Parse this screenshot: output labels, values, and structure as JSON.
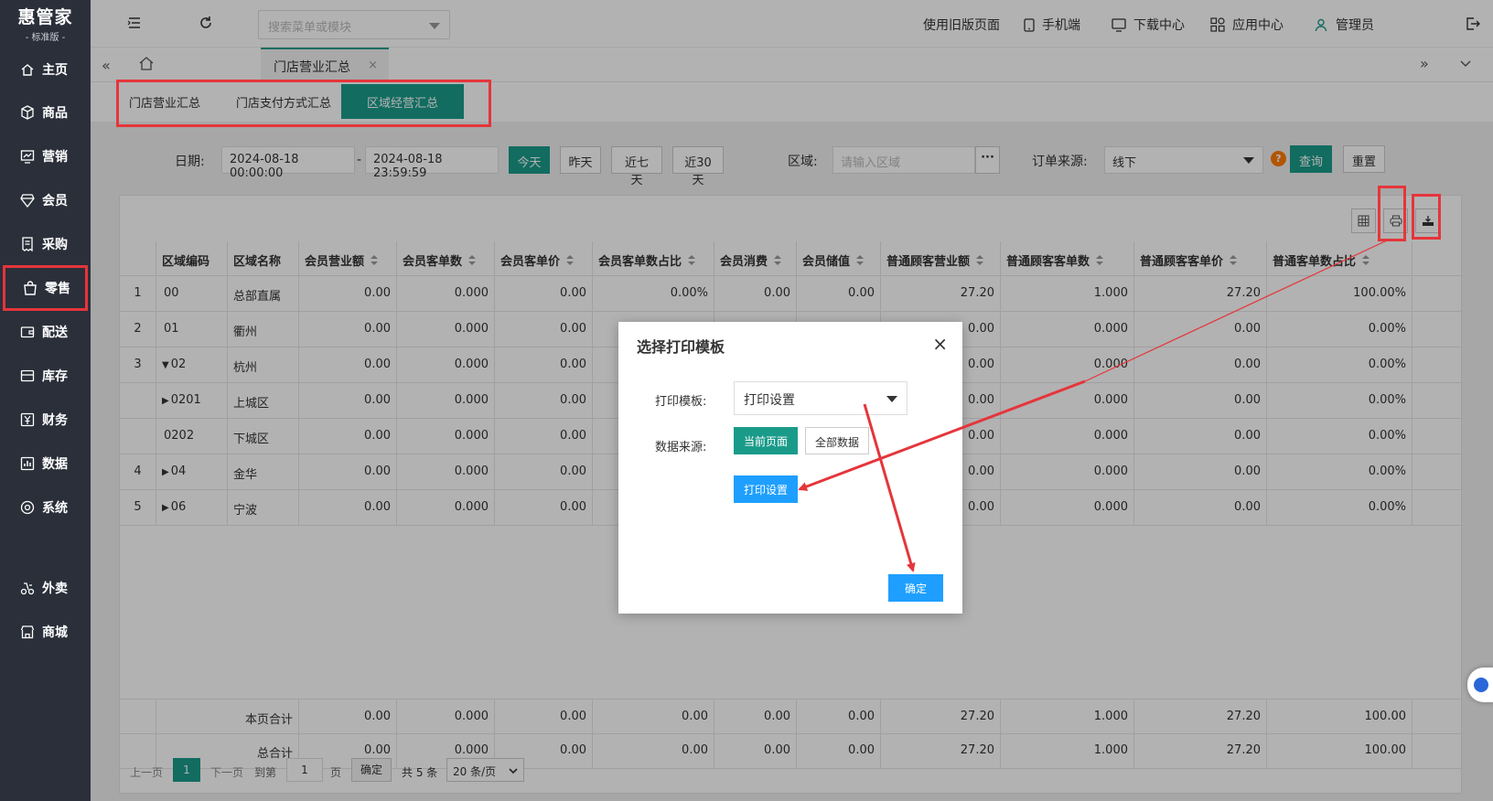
{
  "sidebar": {
    "logo_title": "惠管家",
    "logo_subtitle": "- 标准版 -",
    "items": [
      {
        "label": "主页",
        "icon": "home-icon"
      },
      {
        "label": "商品",
        "icon": "box-icon"
      },
      {
        "label": "营销",
        "icon": "chart-board-icon"
      },
      {
        "label": "会员",
        "icon": "diamond-icon"
      },
      {
        "label": "采购",
        "icon": "receipt-icon"
      },
      {
        "label": "零售",
        "icon": "bag-icon"
      },
      {
        "label": "配送",
        "icon": "wallet-icon"
      },
      {
        "label": "库存",
        "icon": "stack-icon"
      },
      {
        "label": "财务",
        "icon": "yen-icon"
      },
      {
        "label": "数据",
        "icon": "bar-chart-icon"
      },
      {
        "label": "系统",
        "icon": "settings-icon"
      },
      {
        "label": "外卖",
        "icon": "takeout-icon"
      },
      {
        "label": "商城",
        "icon": "shop-icon"
      }
    ]
  },
  "header": {
    "search_placeholder": "搜索菜单或模块",
    "old_page": "使用旧版页面",
    "mobile": "手机端",
    "download": "下载中心",
    "apps": "应用中心",
    "user": "管理员"
  },
  "tabs": {
    "active": "门店营业汇总"
  },
  "subtabs": [
    "门店营业汇总",
    "门店支付方式汇总",
    "区域经营汇总"
  ],
  "filter": {
    "date_label": "日期:",
    "date_start": "2024-08-18 00:00:00",
    "date_sep": "-",
    "date_end": "2024-08-18 23:59:59",
    "today": "今天",
    "yesterday": "昨天",
    "last7": "近七天",
    "last30": "近30天",
    "region_label": "区域:",
    "region_placeholder": "请输入区域",
    "region_more": "···",
    "source_label": "订单来源:",
    "source_value": "线下",
    "help": "?",
    "query": "查询",
    "reset": "重置"
  },
  "table": {
    "columns": [
      "区域编码",
      "区域名称",
      "会员营业额",
      "会员客单数",
      "会员客单价",
      "会员客单数占比",
      "会员消费",
      "会员储值",
      "普通顾客营业额",
      "普通顾客客单数",
      "普通顾客客单价",
      "普通客单数占比"
    ],
    "rows": [
      {
        "idx": "1",
        "code": "00",
        "expand": "",
        "name": "总部直属",
        "v": [
          "0.00",
          "0.000",
          "0.00",
          "0.00%",
          "0.00",
          "0.00",
          "27.20",
          "1.000",
          "27.20",
          "100.00%"
        ]
      },
      {
        "idx": "2",
        "code": "01",
        "expand": "",
        "name": "衢州",
        "v": [
          "0.00",
          "0.000",
          "0.00",
          "",
          "",
          "",
          "0.00",
          "0.000",
          "0.00",
          "0.00%"
        ]
      },
      {
        "idx": "3",
        "code": "02",
        "expand": "▼",
        "name": "杭州",
        "v": [
          "0.00",
          "0.000",
          "0.00",
          "",
          "",
          "",
          "0.00",
          "0.000",
          "0.00",
          "0.00%"
        ]
      },
      {
        "idx": "",
        "code": "0201",
        "expand": "▶",
        "name": "上城区",
        "v": [
          "0.00",
          "0.000",
          "0.00",
          "",
          "",
          "",
          "0.00",
          "0.000",
          "0.00",
          "0.00%"
        ]
      },
      {
        "idx": "",
        "code": "0202",
        "expand": "",
        "name": "下城区",
        "v": [
          "0.00",
          "0.000",
          "0.00",
          "",
          "",
          "",
          "0.00",
          "0.000",
          "0.00",
          "0.00%"
        ]
      },
      {
        "idx": "4",
        "code": "04",
        "expand": "▶",
        "name": "金华",
        "v": [
          "0.00",
          "0.000",
          "0.00",
          "",
          "",
          "",
          "0.00",
          "0.000",
          "0.00",
          "0.00%"
        ]
      },
      {
        "idx": "5",
        "code": "06",
        "expand": "▶",
        "name": "宁波",
        "v": [
          "0.00",
          "0.000",
          "0.00",
          "",
          "",
          "",
          "0.00",
          "0.000",
          "0.00",
          "0.00%"
        ]
      }
    ],
    "totals": [
      {
        "label": "本页合计",
        "v": [
          "0.00",
          "0.000",
          "0.00",
          "0.00",
          "0.00",
          "0.00",
          "27.20",
          "1.000",
          "27.20",
          "100.00"
        ]
      },
      {
        "label": "总合计",
        "v": [
          "0.00",
          "0.000",
          "0.00",
          "0.00",
          "0.00",
          "0.00",
          "27.20",
          "1.000",
          "27.20",
          "100.00"
        ]
      }
    ]
  },
  "pager": {
    "prev": "上一页",
    "current": "1",
    "next": "下一页",
    "goto": "到第",
    "page_input": "1",
    "page_unit": "页",
    "confirm": "确定",
    "total": "共 5 条",
    "per_page": "20 条/页"
  },
  "dialog": {
    "title": "选择打印模板",
    "close": "×",
    "template_label": "打印模板:",
    "template_value": "打印设置",
    "source_label": "数据来源:",
    "current_page": "当前页面",
    "all_data": "全部数据",
    "print_settings": "打印设置",
    "ok": "确定"
  },
  "colors": {
    "accent": "#1a9b8a",
    "sidebar": "#2b2f3a",
    "highlight": "#e5353b",
    "primary": "#1e9fff"
  }
}
